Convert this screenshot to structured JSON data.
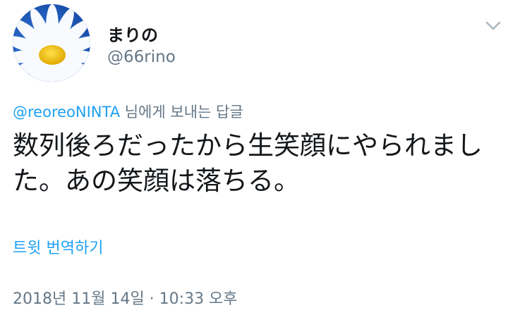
{
  "tweet": {
    "user": {
      "display_name": "まりの",
      "handle": "@66rino",
      "avatar_icon": "daisy-flower-avatar"
    },
    "menu_icon": "chevron-down-icon",
    "reply": {
      "mention": "@reoreoNINTA",
      "suffix": " 님에게 보내는 답글"
    },
    "text": "数列後ろだったから生笑顔にやられました。あの笑顔は落ちる。",
    "translate_label": "트윗 번역하기",
    "timestamp": "2018년 11월 14일 · 10:33 오후"
  },
  "colors": {
    "link": "#1da1f2",
    "secondary_text": "#657786",
    "primary_text": "#14171a"
  }
}
